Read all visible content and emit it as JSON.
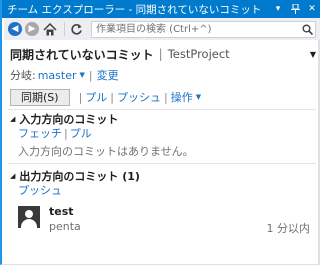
{
  "titlebar": {
    "title": "チーム エクスプローラー - 同期されていないコミット",
    "pin_glyph": "⊽",
    "pin2_glyph": "ᛘ",
    "close_glyph": "✕"
  },
  "toolbar": {
    "search_placeholder": "作業項目の検索 (Ctrl+^)"
  },
  "header": {
    "title": "同期されていないコミット",
    "separator": "|",
    "project": "TestProject"
  },
  "branch": {
    "label": "分岐:",
    "value": "master",
    "change_link": "変更",
    "separator": "|"
  },
  "actions": {
    "sync_button": "同期(S)",
    "pull": "プル",
    "push": "プッシュ",
    "operations": "操作",
    "separator": "|"
  },
  "incoming": {
    "title": "入力方向のコミット",
    "fetch": "フェッチ",
    "pull": "プル",
    "separator": "|",
    "empty_message": "入力方向のコミットはありません。"
  },
  "outgoing": {
    "title": "出力方向のコミット (1)",
    "push": "プッシュ",
    "commits": [
      {
        "message": "test",
        "author": "penta",
        "time": "1 分以内"
      }
    ]
  },
  "colors": {
    "titlebar": "#007acc",
    "link": "#1e72c9",
    "toolbar": "#eeeef2"
  }
}
